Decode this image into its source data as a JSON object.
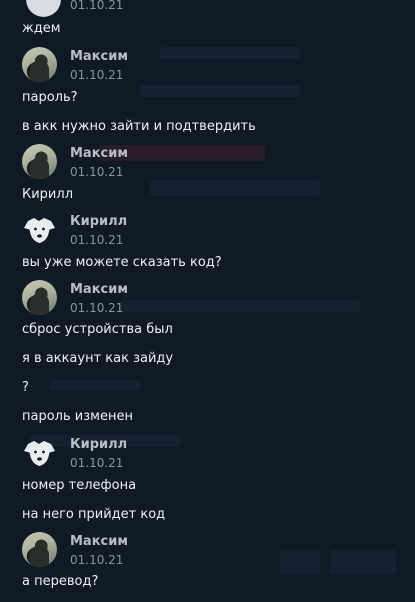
{
  "messages": [
    {
      "type": "date",
      "text": "01.10.21"
    },
    {
      "type": "text",
      "text": "ждем"
    },
    {
      "type": "author",
      "name": "Максим",
      "date": "01.10.21",
      "avatar": "photo"
    },
    {
      "type": "text",
      "text": "пароль?"
    },
    {
      "type": "text",
      "text": "в акк нужно зайти и подтвердить"
    },
    {
      "type": "author",
      "name": "Максим",
      "date": "01.10.21",
      "avatar": "photo"
    },
    {
      "type": "text",
      "text": "Кирилл"
    },
    {
      "type": "author",
      "name": "Кирилл",
      "date": "01.10.21",
      "avatar": "dog"
    },
    {
      "type": "text",
      "text": "вы уже можете сказать код?"
    },
    {
      "type": "author",
      "name": "Максим",
      "date": "01.10.21",
      "avatar": "photo"
    },
    {
      "type": "text",
      "text": "сброс устройства был"
    },
    {
      "type": "text",
      "text": "я в аккаунт как зайду"
    },
    {
      "type": "text",
      "text": "?"
    },
    {
      "type": "text",
      "text": "пароль изменен"
    },
    {
      "type": "author",
      "name": "Кирилл",
      "date": "01.10.21",
      "avatar": "dog"
    },
    {
      "type": "text",
      "text": "номер телефона"
    },
    {
      "type": "text",
      "text": "на него прийдет код"
    },
    {
      "type": "author",
      "name": "Максим",
      "date": "01.10.21",
      "avatar": "photo"
    },
    {
      "type": "text",
      "text": "а перевод?"
    }
  ]
}
